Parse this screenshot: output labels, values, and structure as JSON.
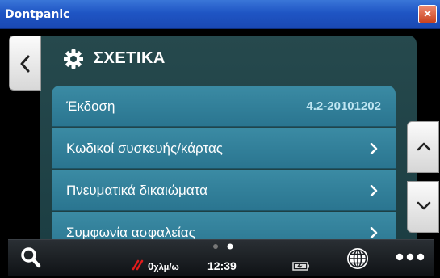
{
  "window": {
    "title": "Dontpanic",
    "close_label": "×"
  },
  "header": {
    "title": "ΣΧΕΤΙΚΑ",
    "icon": "gear-icon"
  },
  "list": {
    "items": [
      {
        "label": "Έκδοση",
        "value": "4.2-20101202"
      },
      {
        "label": "Κωδικοί συσκευής/κάρτας",
        "value": ""
      },
      {
        "label": "Πνευματικά δικαιώματα",
        "value": ""
      },
      {
        "label": "Συμφωνία ασφαλείας",
        "value": ""
      }
    ]
  },
  "status": {
    "speed_value": "0",
    "speed_unit": "χλμ/ω",
    "time": "12:39",
    "page_indicator": {
      "pages": 2,
      "current": 2
    }
  },
  "colors": {
    "titlebar": "#1f55c4",
    "panel": "#1c3e43",
    "row": "#2a7590",
    "value_text": "#bfe6f2",
    "speed_icon": "#e21b1b"
  }
}
